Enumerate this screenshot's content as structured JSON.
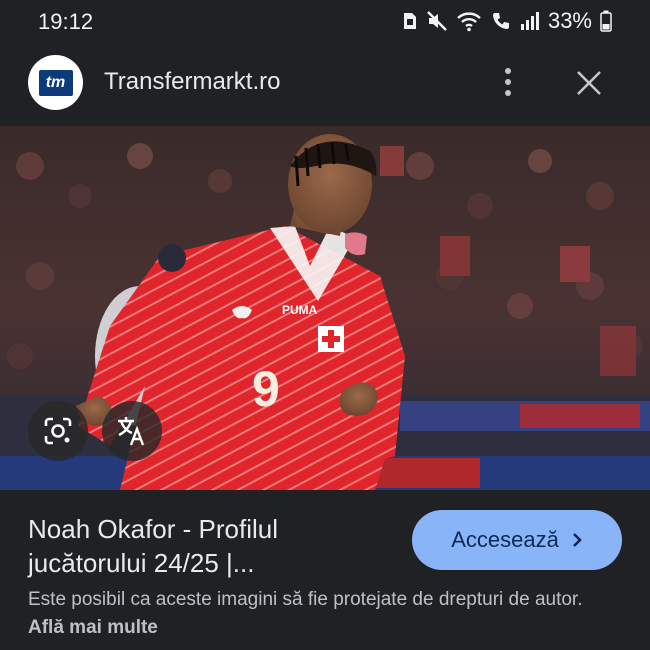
{
  "status_bar": {
    "time": "19:12",
    "battery": "33%",
    "icons": [
      "sim-icon",
      "mute-icon",
      "wifi-icon",
      "call-icon",
      "signal-icon",
      "battery-icon"
    ]
  },
  "header": {
    "logo_text": "tm",
    "site_name": "Transfermarkt.ro",
    "menu_icon": "more-vert-icon",
    "close_icon": "close-icon"
  },
  "image": {
    "jersey_brand": "PUMA",
    "jersey_number": "9",
    "lens_icon": "google-lens-icon",
    "translate_icon": "translate-icon"
  },
  "result": {
    "title": "Noah Okafor - Profilul jucătorului 24/25 |...",
    "visit_label": "Accesează",
    "disclaimer": "Este posibil ca aceste imagini să fie protejate de drepturi de autor.",
    "learn_more": "Află mai multe"
  },
  "colors": {
    "background": "#202124",
    "button": "#8ab4f8",
    "jersey": "#e0262c"
  }
}
